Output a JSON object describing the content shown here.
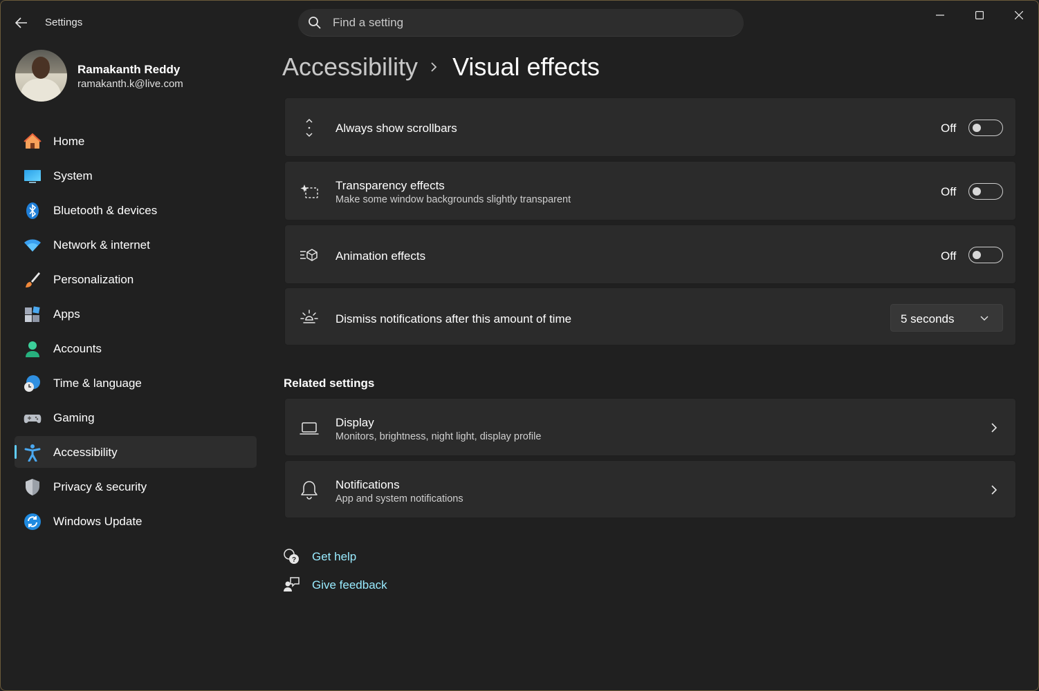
{
  "window": {
    "app_title": "Settings",
    "controls": {
      "minimize": "minimize-icon",
      "maximize": "maximize-icon",
      "close": "close-icon"
    }
  },
  "search": {
    "placeholder": "Find a setting",
    "value": ""
  },
  "user": {
    "name": "Ramakanth Reddy",
    "email": "ramakanth.k@live.com"
  },
  "sidebar": {
    "accent": "#60cdff",
    "items": [
      {
        "label": "Home",
        "icon": "home-icon",
        "selected": false
      },
      {
        "label": "System",
        "icon": "system-icon",
        "selected": false
      },
      {
        "label": "Bluetooth & devices",
        "icon": "bluetooth-icon",
        "selected": false
      },
      {
        "label": "Network & internet",
        "icon": "wifi-icon",
        "selected": false
      },
      {
        "label": "Personalization",
        "icon": "brush-icon",
        "selected": false
      },
      {
        "label": "Apps",
        "icon": "apps-icon",
        "selected": false
      },
      {
        "label": "Accounts",
        "icon": "accounts-icon",
        "selected": false
      },
      {
        "label": "Time & language",
        "icon": "globe-clock-icon",
        "selected": false
      },
      {
        "label": "Gaming",
        "icon": "gamepad-icon",
        "selected": false
      },
      {
        "label": "Accessibility",
        "icon": "accessibility-icon",
        "selected": true
      },
      {
        "label": "Privacy & security",
        "icon": "shield-icon",
        "selected": false
      },
      {
        "label": "Windows Update",
        "icon": "update-icon",
        "selected": false
      }
    ]
  },
  "breadcrumb": {
    "parent": "Accessibility",
    "current": "Visual effects"
  },
  "settings": [
    {
      "title": "Always show scrollbars",
      "subtitle": "",
      "state": "Off",
      "control": "toggle",
      "on": false,
      "icon": "scrollbar-icon"
    },
    {
      "title": "Transparency effects",
      "subtitle": "Make some window backgrounds slightly transparent",
      "state": "Off",
      "control": "toggle",
      "on": false,
      "icon": "transparency-icon"
    },
    {
      "title": "Animation effects",
      "subtitle": "",
      "state": "Off",
      "control": "toggle",
      "on": false,
      "icon": "animation-icon"
    },
    {
      "title": "Dismiss notifications after this amount of time",
      "subtitle": "",
      "control": "dropdown",
      "value": "5 seconds",
      "icon": "brightness-icon"
    }
  ],
  "related": {
    "title": "Related settings",
    "items": [
      {
        "title": "Display",
        "subtitle": "Monitors, brightness, night light, display profile",
        "icon": "laptop-icon"
      },
      {
        "title": "Notifications",
        "subtitle": "App and system notifications",
        "icon": "bell-icon"
      }
    ]
  },
  "links": [
    {
      "label": "Get help",
      "icon": "help-icon"
    },
    {
      "label": "Give feedback",
      "icon": "feedback-icon"
    }
  ]
}
